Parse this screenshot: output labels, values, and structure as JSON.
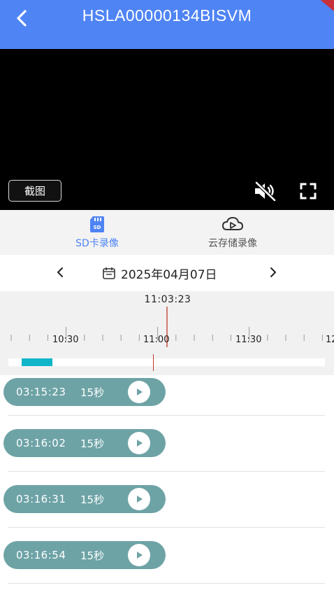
{
  "header": {
    "title": "HSLA00000134BISVM"
  },
  "video": {
    "screenshot_label": "截图"
  },
  "tabs": [
    {
      "label": "SD卡录像",
      "icon": "sd-card-icon",
      "active": true
    },
    {
      "label": "云存储录像",
      "icon": "cloud-play-icon",
      "active": false
    }
  ],
  "date": {
    "value": "2025年04月07日"
  },
  "timeline": {
    "current_time": "11:03:23",
    "tick_labels": [
      "10:30",
      "11:00",
      "11:30",
      "12"
    ]
  },
  "recordings": [
    {
      "time": "03:15:23",
      "duration": "15秒"
    },
    {
      "time": "03:16:02",
      "duration": "15秒"
    },
    {
      "time": "03:16:31",
      "duration": "15秒"
    },
    {
      "time": "03:16:54",
      "duration": "15秒"
    }
  ],
  "colors": {
    "header": "#4f84f4",
    "segment": "#11b5c9",
    "pill": "#6ea3a6",
    "cursor": "#c0392b"
  }
}
